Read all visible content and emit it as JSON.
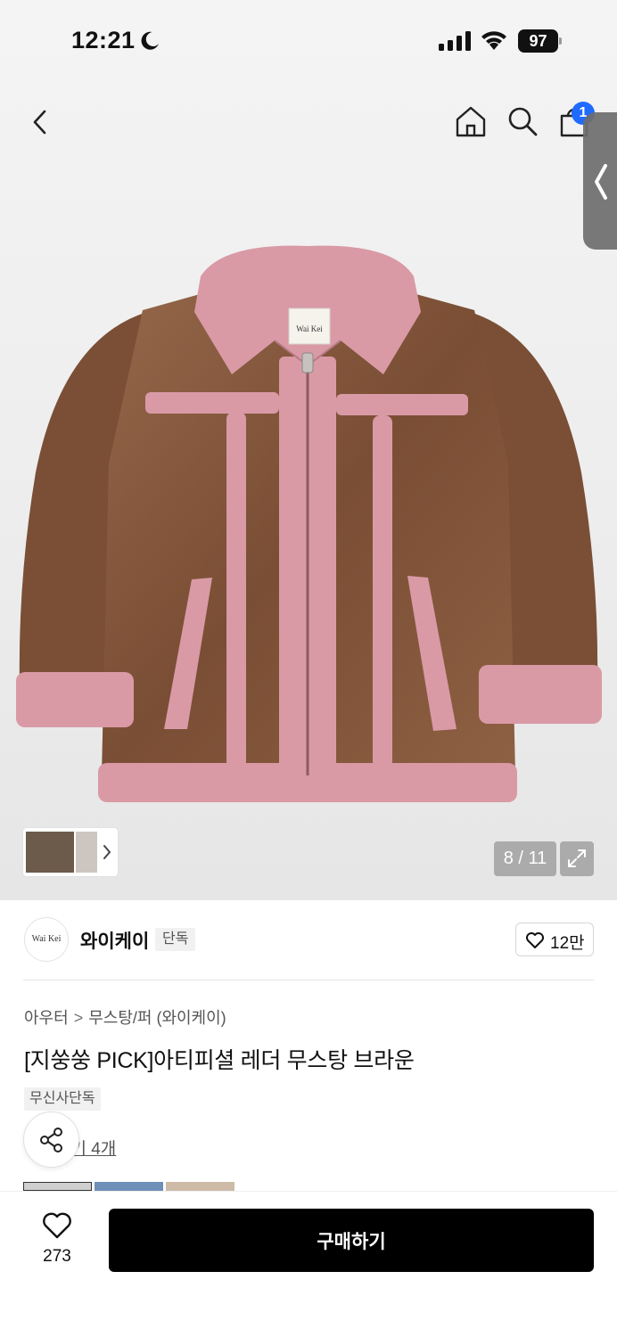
{
  "status_bar": {
    "time": "12:21",
    "battery": "97"
  },
  "nav": {
    "cart_count": "1"
  },
  "image_counter": "8 / 11",
  "brand": {
    "logo_text": "Wai Kei",
    "name": "와이케이",
    "tag": "단독",
    "likes": "12만"
  },
  "breadcrumb": {
    "category": "아우터",
    "separator": ">",
    "subcategory": "무스탕/퍼 (와이케이)"
  },
  "product": {
    "title": "[지쑹쑹 PICK]아티피셜 레더 무스탕 브라운",
    "exclusive_tag": "무신사단독",
    "reviews_link": "후기 4개"
  },
  "bottom_bar": {
    "wish_count": "273",
    "buy_label": "구매하기"
  },
  "colors": {
    "accent_blue": "#1f6bff",
    "jacket_brown": "#7a4f36",
    "shearling_pink": "#d99aa6",
    "button_black": "#000000"
  },
  "icons": [
    "back-icon",
    "home-icon",
    "search-icon",
    "cart-icon",
    "chevron-left-icon",
    "chevron-right-icon",
    "expand-icon",
    "heart-icon",
    "share-icon",
    "moon-icon",
    "signal-icon",
    "wifi-icon"
  ]
}
